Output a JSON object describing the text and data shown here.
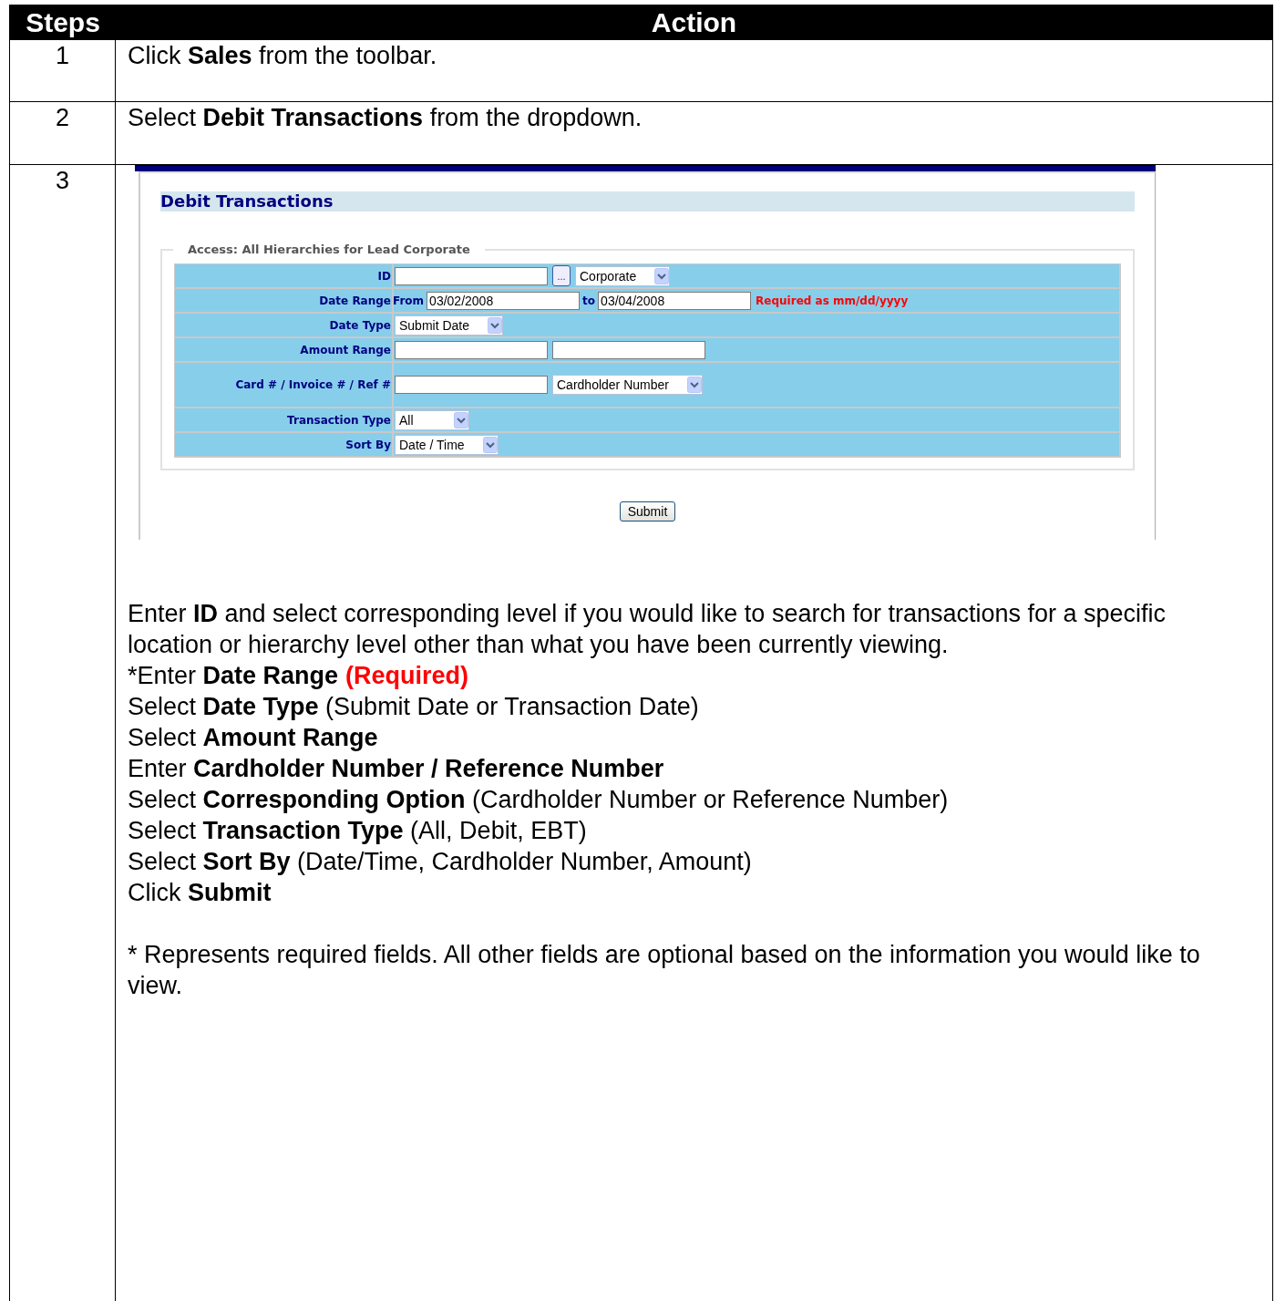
{
  "table": {
    "columns": [
      "Steps",
      "Action"
    ],
    "rows": [
      {
        "step": "1",
        "text": "Click **Sales** from the toolbar."
      },
      {
        "step": "2",
        "text": "Select **Debit Transactions** from the dropdown."
      },
      {
        "step": "3",
        "screenshot": {
          "title": "Debit Transactions",
          "access": "Access: All Hierarchies for Lead Corporate",
          "form": [
            {
              "label": "ID",
              "tall": false,
              "controls": [
                {
                  "kind": "input"
                },
                {
                  "kind": "button",
                  "text": "..."
                },
                {
                  "kind": "select",
                  "value": "Corporate"
                }
              ]
            },
            {
              "label": "Date Range",
              "tall": false,
              "controls": [
                {
                  "kind": "text",
                  "text": "From"
                },
                {
                  "kind": "input",
                  "value": "03/02/2008"
                },
                {
                  "kind": "text",
                  "text": "to"
                },
                {
                  "kind": "input",
                  "value": "03/04/2008"
                },
                {
                  "kind": "note",
                  "text": "Required as mm/dd/yyyy"
                }
              ]
            },
            {
              "label": "Date Type",
              "tall": false,
              "controls": [
                {
                  "kind": "select",
                  "value": "Submit Date"
                }
              ]
            },
            {
              "label": "Amount Range",
              "tall": false,
              "controls": [
                {
                  "kind": "input"
                },
                {
                  "kind": "input"
                }
              ]
            },
            {
              "label": "Card # / Invoice # / Ref #",
              "tall": true,
              "controls": [
                {
                  "kind": "input"
                },
                {
                  "kind": "select",
                  "value": "Cardholder Number"
                }
              ]
            },
            {
              "label": "Transaction Type",
              "tall": false,
              "controls": [
                {
                  "kind": "select",
                  "value": "All"
                }
              ]
            },
            {
              "label": "Sort By",
              "tall": false,
              "controls": [
                {
                  "kind": "select",
                  "value": "Date / Time"
                }
              ]
            }
          ],
          "submit": "Submit"
        },
        "lines": [
          {
            "text": "Enter **ID** and select corresponding level if you would like to search for transactions for a specific location or hierarchy level other than what you have been currently viewing."
          },
          {
            "text": "*Enter **Date Range**",
            "flag": "(Required)"
          },
          {
            "text": "Select **Date Type** (Submit Date or Transaction Date)"
          },
          {
            "text": "Select **Amount Range**"
          },
          {
            "text": "Enter **Cardholder Number / Reference Number**"
          },
          {
            "text": "Select **Corresponding Option** (Cardholder Number or Reference Number)"
          },
          {
            "text": "Select **Transaction Type** (All, Debit, EBT)"
          },
          {
            "text": "Select **Sort By** (Date/Time, Cardholder Number, Amount)"
          },
          {
            "text": "Click **Submit**"
          }
        ],
        "footnote": "* Represents required fields. All other fields are optional based on the information you would like to view."
      }
    ]
  }
}
